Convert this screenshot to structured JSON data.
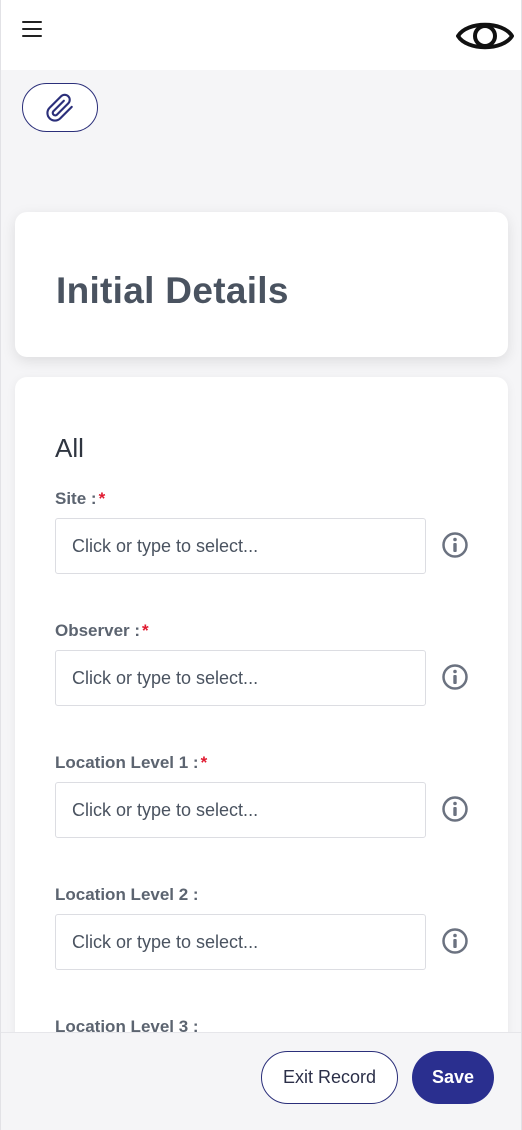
{
  "header": {
    "menu_icon": "hamburger-menu-icon",
    "preview_icon": "eye-icon"
  },
  "toolbar": {
    "attach_icon": "paperclip-icon"
  },
  "title_card": {
    "title": "Initial Details"
  },
  "form": {
    "section_title": "All",
    "fields": [
      {
        "label": "Site :",
        "required": true,
        "required_mark": "*",
        "placeholder": "Click or type to select...",
        "value": ""
      },
      {
        "label": "Observer :",
        "required": true,
        "required_mark": "*",
        "placeholder": "Click or type to select...",
        "value": ""
      },
      {
        "label": "Location Level 1 :",
        "required": true,
        "required_mark": "*",
        "placeholder": "Click or type to select...",
        "value": ""
      },
      {
        "label": "Location Level 2 :",
        "required": false,
        "required_mark": "",
        "placeholder": "Click or type to select...",
        "value": ""
      },
      {
        "label": "Location Level 3 :",
        "required": false,
        "required_mark": "",
        "placeholder": "",
        "value": ""
      }
    ]
  },
  "footer": {
    "exit_label": "Exit Record",
    "save_label": "Save"
  },
  "colors": {
    "accent": "#2a2f8f",
    "required": "#e0182e",
    "text": "#4a5360"
  }
}
